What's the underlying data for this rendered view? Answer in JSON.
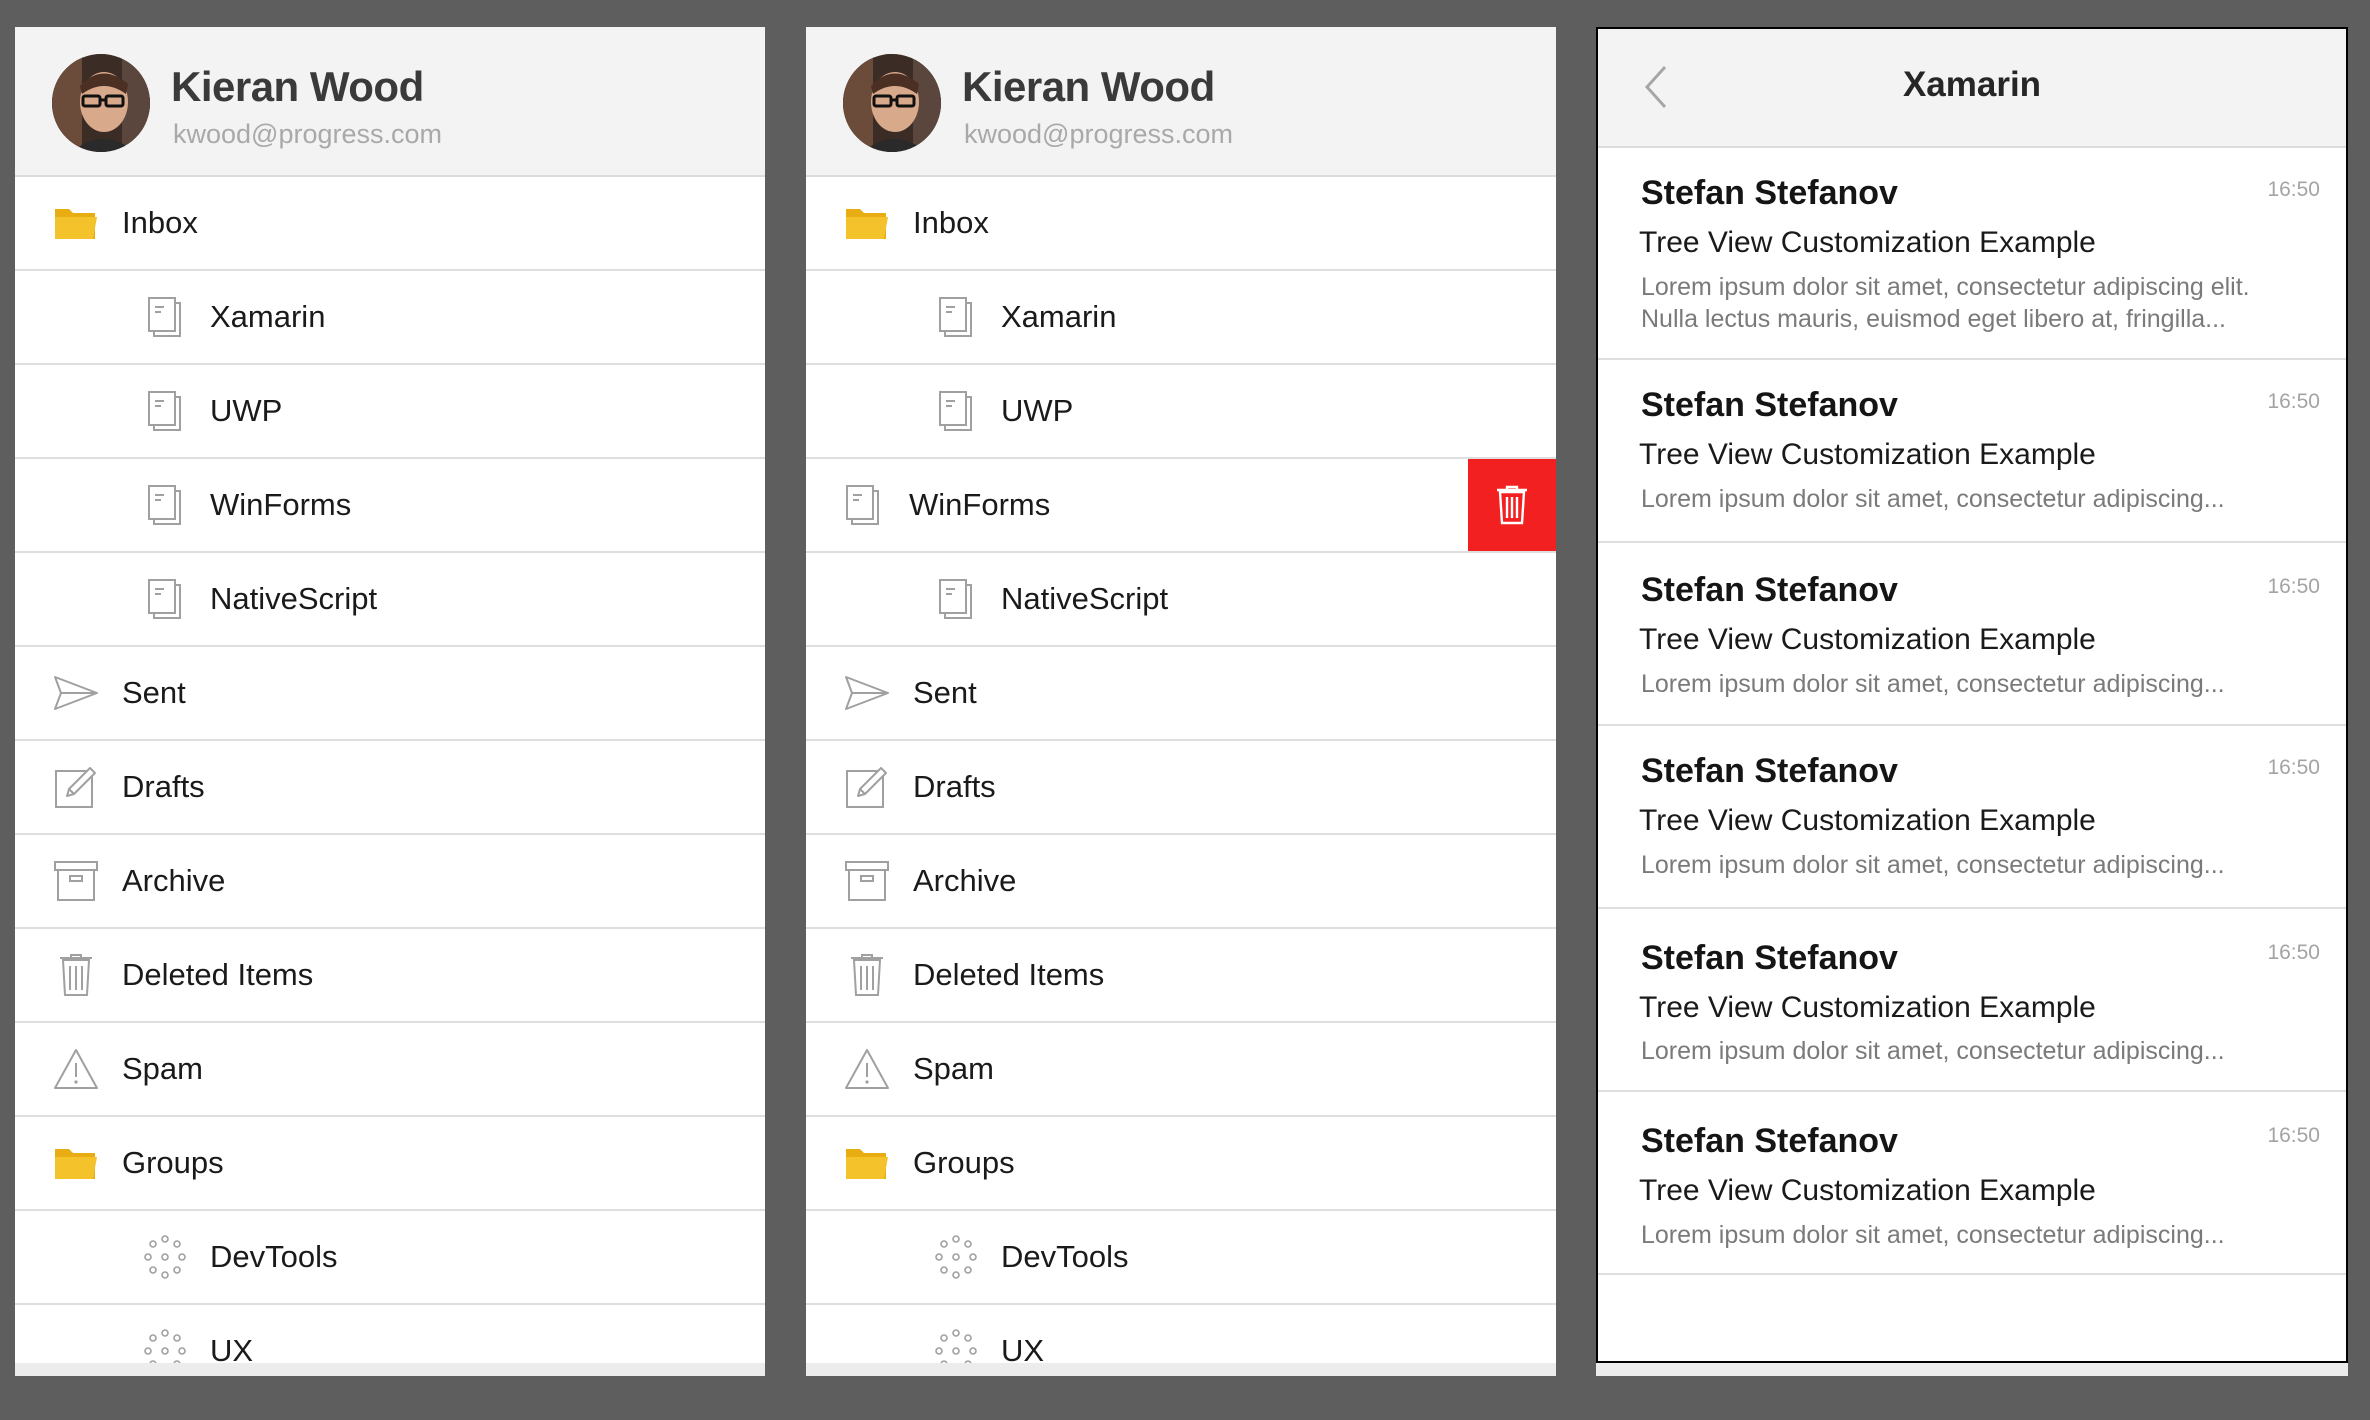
{
  "profile": {
    "name": "Kieran Wood",
    "email": "kwood@progress.com"
  },
  "tree": {
    "items": [
      {
        "label": "Inbox",
        "icon": "folder-icon",
        "level": 0
      },
      {
        "label": "Xamarin",
        "icon": "document-icon",
        "level": 1
      },
      {
        "label": "UWP",
        "icon": "document-icon",
        "level": 1
      },
      {
        "label": "WinForms",
        "icon": "document-icon",
        "level": 1
      },
      {
        "label": "NativeScript",
        "icon": "document-icon",
        "level": 1
      },
      {
        "label": "Sent",
        "icon": "send-icon",
        "level": 0
      },
      {
        "label": "Drafts",
        "icon": "pencil-icon",
        "level": 0
      },
      {
        "label": "Archive",
        "icon": "archive-icon",
        "level": 0
      },
      {
        "label": "Deleted Items",
        "icon": "trash-icon",
        "level": 0
      },
      {
        "label": "Spam",
        "icon": "warning-icon",
        "level": 0
      },
      {
        "label": "Groups",
        "icon": "folder-icon",
        "level": 0
      },
      {
        "label": "DevTools",
        "icon": "group-icon",
        "level": 1
      },
      {
        "label": "UX",
        "icon": "group-icon",
        "level": 1
      }
    ],
    "swipe_action_icon": "trash-icon"
  },
  "mail": {
    "title": "Xamarin",
    "items": [
      {
        "sender": "Stefan Stefanov",
        "time": "16:50",
        "subject": "Tree View Customization Example",
        "preview_lines": [
          "Lorem ipsum dolor sit amet, consectetur adipiscing elit.",
          "Nulla lectus mauris, euismod eget libero at, fringilla..."
        ]
      },
      {
        "sender": "Stefan Stefanov",
        "time": "16:50",
        "subject": "Tree View Customization Example",
        "preview_lines": [
          "Lorem ipsum dolor sit amet, consectetur adipiscing..."
        ]
      },
      {
        "sender": "Stefan Stefanov",
        "time": "16:50",
        "subject": "Tree View Customization Example",
        "preview_lines": [
          "Lorem ipsum dolor sit amet, consectetur adipiscing..."
        ]
      },
      {
        "sender": "Stefan Stefanov",
        "time": "16:50",
        "subject": "Tree View Customization Example",
        "preview_lines": [
          "Lorem ipsum dolor sit amet, consectetur adipiscing..."
        ]
      },
      {
        "sender": "Stefan Stefanov",
        "time": "16:50",
        "subject": "Tree View Customization Example",
        "preview_lines": [
          "Lorem ipsum dolor sit amet, consectetur adipiscing..."
        ]
      },
      {
        "sender": "Stefan Stefanov",
        "time": "16:50",
        "subject": "Tree View Customization Example",
        "preview_lines": [
          "Lorem ipsum dolor sit amet, consectetur adipiscing..."
        ]
      }
    ]
  },
  "colors": {
    "background": "#5e5e5e",
    "header": "#f3f3f3",
    "folder": "#f4c22b",
    "delete": "#f22020",
    "icon_stroke": "#9a9a9a"
  }
}
